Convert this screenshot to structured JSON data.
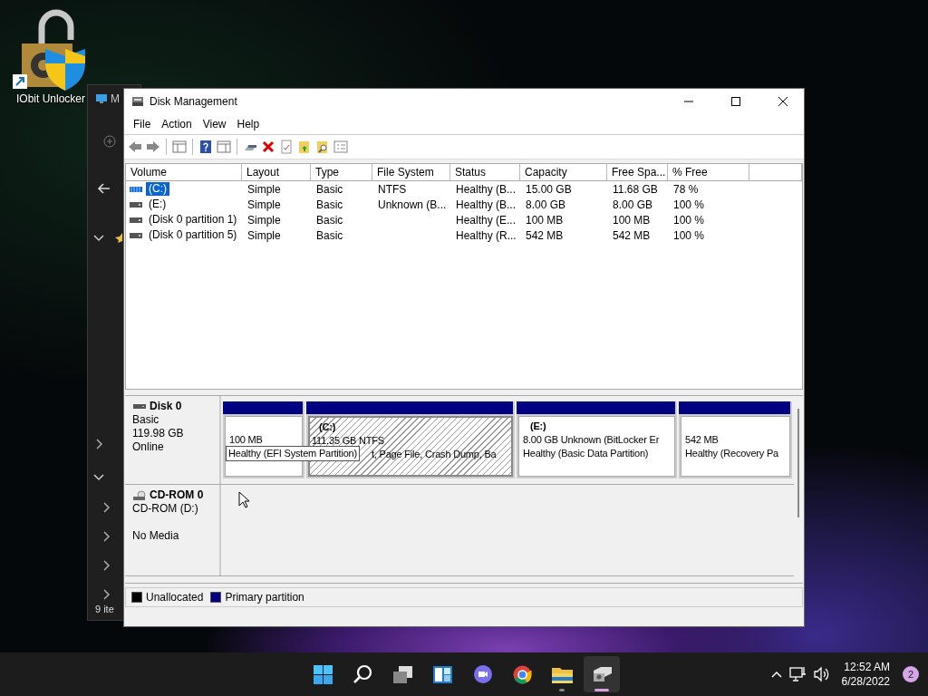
{
  "desktop_icons": [
    {
      "label": "IObit Unlocker"
    }
  ],
  "background_window": {
    "title": "M",
    "status": "9 ite"
  },
  "window": {
    "title": "Disk Management"
  },
  "menu": [
    "File",
    "Action",
    "View",
    "Help"
  ],
  "volume_table": {
    "columns": [
      "Volume",
      "Layout",
      "Type",
      "File System",
      "Status",
      "Capacity",
      "Free Spa...",
      "% Free"
    ],
    "rows": [
      {
        "cells": [
          "(C:)",
          "Simple",
          "Basic",
          "NTFS",
          "Healthy (B...",
          "15.00 GB",
          "11.68 GB",
          "78 %"
        ],
        "selected": true
      },
      {
        "cells": [
          "(E:)",
          "Simple",
          "Basic",
          "Unknown (B...",
          "Healthy (B...",
          "8.00 GB",
          "8.00 GB",
          "100 %"
        ],
        "selected": false
      },
      {
        "cells": [
          "(Disk 0 partition 1)",
          "Simple",
          "Basic",
          "",
          "Healthy (E...",
          "100 MB",
          "100 MB",
          "100 %"
        ],
        "selected": false
      },
      {
        "cells": [
          "(Disk 0 partition 5)",
          "Simple",
          "Basic",
          "",
          "Healthy (R...",
          "542 MB",
          "542 MB",
          "100 %"
        ],
        "selected": false
      }
    ]
  },
  "disks": [
    {
      "kind": "disk",
      "name": "Disk 0",
      "lines": [
        "Basic",
        "119.98 GB"
      ],
      "status": "Online",
      "partitions": [
        {
          "lines": [
            "100 MB"
          ],
          "selected": false
        },
        {
          "title": "(C:)",
          "lines": [
            "111.35 GB NTFS",
            "t, Page File, Crash Dump, Ba"
          ],
          "selected": true
        },
        {
          "title": "(E:)",
          "lines": [
            "8.00 GB Unknown (BitLocker Er",
            "Healthy (Basic Data Partition)"
          ],
          "selected": false
        },
        {
          "lines": [
            "542 MB",
            "Healthy (Recovery Pa"
          ],
          "selected": false
        }
      ]
    },
    {
      "kind": "cdrom",
      "name": "CD-ROM 0",
      "lines": [
        "CD-ROM (D:)"
      ],
      "status": "No Media"
    }
  ],
  "tooltip": "Healthy (EFI System Partition)",
  "legend": [
    {
      "label": "Unallocated",
      "color": "#000000"
    },
    {
      "label": "Primary partition",
      "color": "#000080"
    }
  ],
  "taskbar": {
    "apps": [
      {
        "kind": "start",
        "running": false,
        "active": false
      },
      {
        "kind": "search",
        "running": false,
        "active": false
      },
      {
        "kind": "taskview",
        "running": false,
        "active": false
      },
      {
        "kind": "widgets",
        "running": false,
        "active": false
      },
      {
        "kind": "chat",
        "running": false,
        "active": false
      },
      {
        "kind": "browser",
        "running": false,
        "active": false
      },
      {
        "kind": "explorer",
        "running": true,
        "active": false
      },
      {
        "kind": "diskmgmt",
        "running": true,
        "active": true
      }
    ],
    "clock": {
      "time": "12:52 AM",
      "date": "6/28/2022"
    },
    "notifications": "2"
  }
}
